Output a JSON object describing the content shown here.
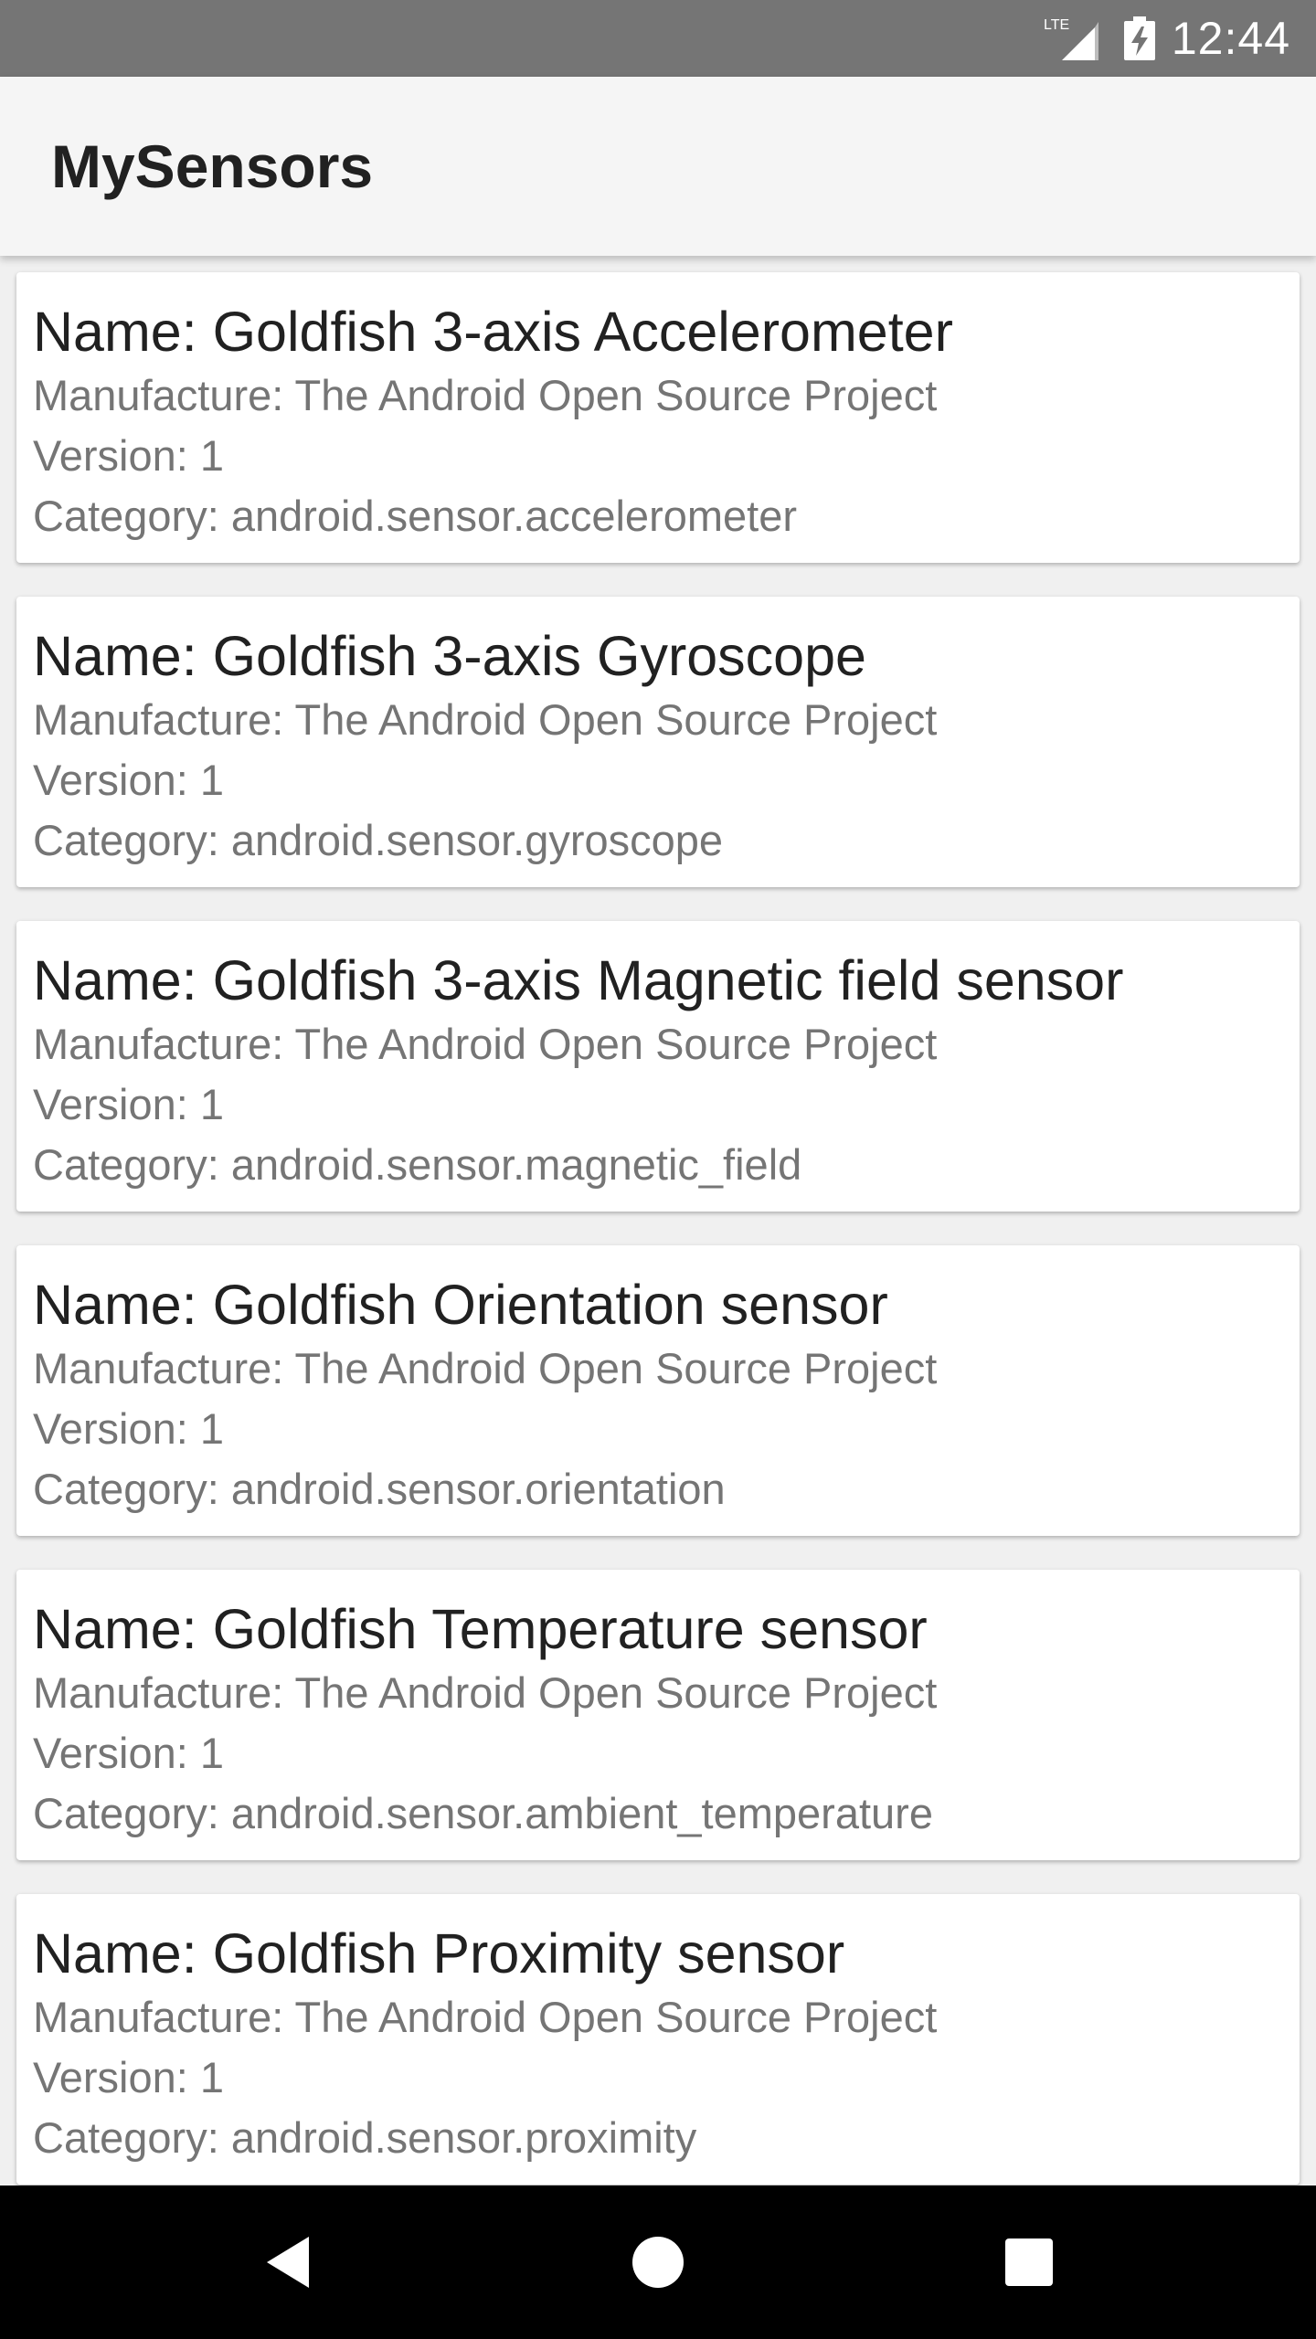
{
  "status_bar": {
    "network": "LTE",
    "time": "12:44",
    "icons": [
      "lte-signal-icon",
      "battery-charging-icon"
    ]
  },
  "app_bar": {
    "title": "MySensors"
  },
  "sensors": [
    {
      "name": "Name: Goldfish 3-axis Accelerometer",
      "manufacture": "Manufacture: The Android Open Source Project",
      "version": "Version: 1",
      "category": "Category: android.sensor.accelerometer"
    },
    {
      "name": "Name: Goldfish 3-axis Gyroscope",
      "manufacture": "Manufacture: The Android Open Source Project",
      "version": "Version: 1",
      "category": "Category: android.sensor.gyroscope"
    },
    {
      "name": "Name: Goldfish 3-axis Magnetic field sensor",
      "manufacture": "Manufacture: The Android Open Source Project",
      "version": "Version: 1",
      "category": "Category: android.sensor.magnetic_field"
    },
    {
      "name": "Name: Goldfish Orientation sensor",
      "manufacture": "Manufacture: The Android Open Source Project",
      "version": "Version: 1",
      "category": "Category: android.sensor.orientation"
    },
    {
      "name": "Name: Goldfish Temperature sensor",
      "manufacture": "Manufacture: The Android Open Source Project",
      "version": "Version: 1",
      "category": "Category: android.sensor.ambient_temperature"
    },
    {
      "name": "Name: Goldfish Proximity sensor",
      "manufacture": "Manufacture: The Android Open Source Project",
      "version": "Version: 1",
      "category": "Category: android.sensor.proximity"
    }
  ],
  "nav_bar": {
    "buttons": [
      "back-icon",
      "home-icon",
      "recents-icon"
    ]
  },
  "colors": {
    "status_bar": "#757575",
    "app_bar": "#f5f5f5",
    "background": "#f0f0f0",
    "card": "#ffffff",
    "primary_text": "#212121",
    "secondary_text": "#757575",
    "nav_bar": "#000000"
  }
}
